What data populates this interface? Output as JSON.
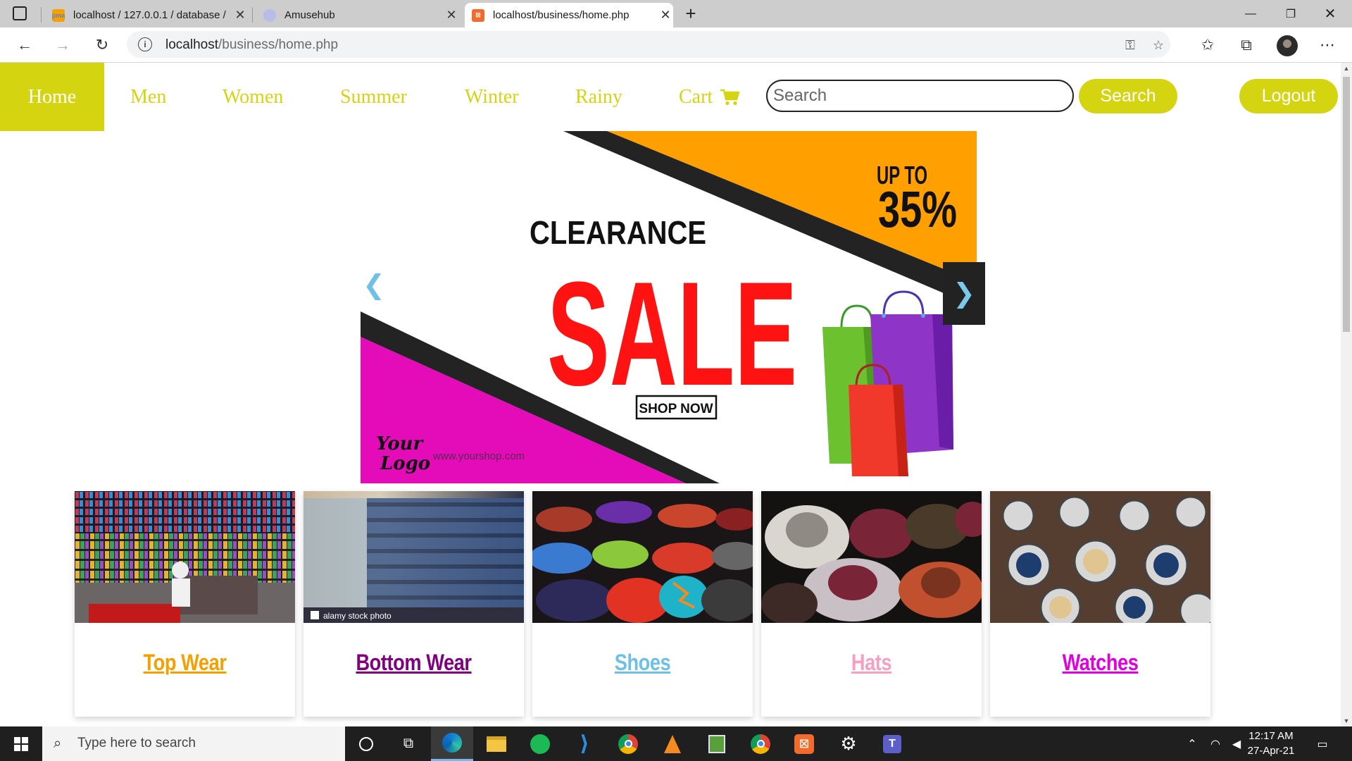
{
  "browser": {
    "tabs": [
      {
        "title": "localhost / 127.0.0.1 / database /",
        "favicon": "phpmyadmin-icon",
        "active": false
      },
      {
        "title": "Amusehub",
        "favicon": "amusehub-icon",
        "active": false
      },
      {
        "title": "localhost/business/home.php",
        "favicon": "xampp-icon",
        "active": true
      }
    ],
    "url_host": "localhost",
    "url_path": "/business/home.php"
  },
  "site": {
    "nav": [
      {
        "label": "Home",
        "active": true
      },
      {
        "label": "Men"
      },
      {
        "label": "Women"
      },
      {
        "label": "Summer"
      },
      {
        "label": "Winter"
      },
      {
        "label": "Rainy"
      },
      {
        "label": "Cart"
      }
    ],
    "search_placeholder": "Search",
    "search_button": "Search",
    "logout_button": "Logout",
    "accent_color": "#d4d410"
  },
  "banner": {
    "line1": "CLEARANCE",
    "headline": "SALE",
    "offer_top": "UP TO",
    "offer_value": "35%",
    "cta": "SHOP NOW",
    "logo_line1": "Your",
    "logo_line2": "Logo",
    "website": "www.yourshop.com"
  },
  "categories": [
    {
      "label": "Top Wear",
      "color": "#f5a000"
    },
    {
      "label": "Bottom Wear",
      "color": "#800080"
    },
    {
      "label": "Shoes",
      "color": "#6ec1e4"
    },
    {
      "label": "Hats",
      "color": "#f5a0c0"
    },
    {
      "label": "Watches",
      "color": "#e000e0"
    }
  ],
  "watermark": "alamy stock photo",
  "taskbar": {
    "search_placeholder": "Type here to search",
    "time": "12:17 AM",
    "date": "27-Apr-21"
  }
}
